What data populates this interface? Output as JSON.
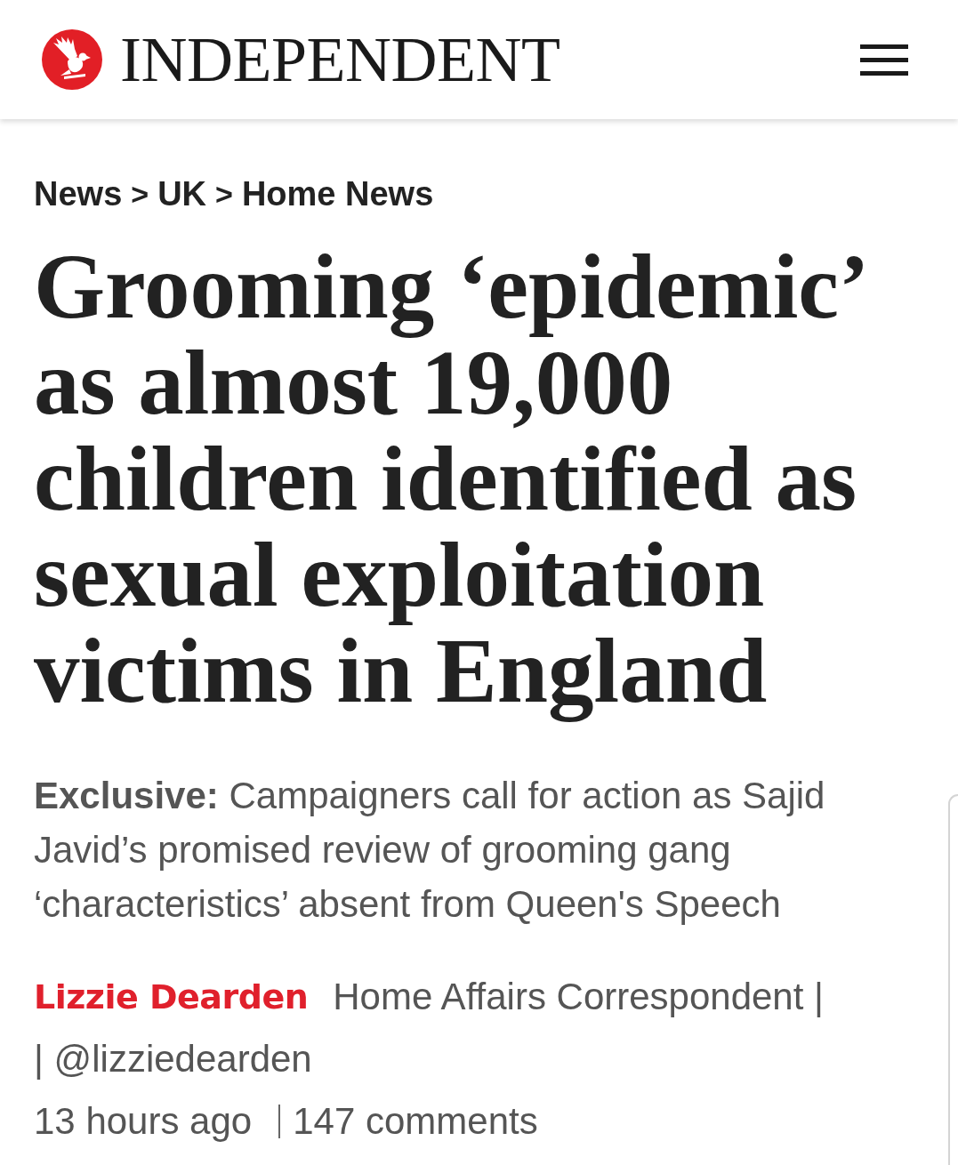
{
  "header": {
    "site_name": "INDEPENDENT"
  },
  "breadcrumb": [
    {
      "kind": "link",
      "text": "News"
    },
    {
      "kind": "separator",
      "text": ">"
    },
    {
      "kind": "link",
      "text": "UK"
    },
    {
      "kind": "separator",
      "text": ">"
    },
    {
      "kind": "link",
      "text": "Home News"
    }
  ],
  "headline": "Grooming ‘epidemic’ as almost 19,000 children identified as sexual exploitation victims in England",
  "standfirst": "**Exclusive:** Campaigners call for action as Sajid Javid’s promised review of grooming gang ‘characteristics’ absent from Queen's Speech",
  "byline": {
    "author": "Lizzie Dearden",
    "role": "Home Affairs Correspondent |",
    "handle": "| @lizziedearden"
  },
  "meta": {
    "time": "13 hours ago",
    "comments": "147 comments"
  }
}
